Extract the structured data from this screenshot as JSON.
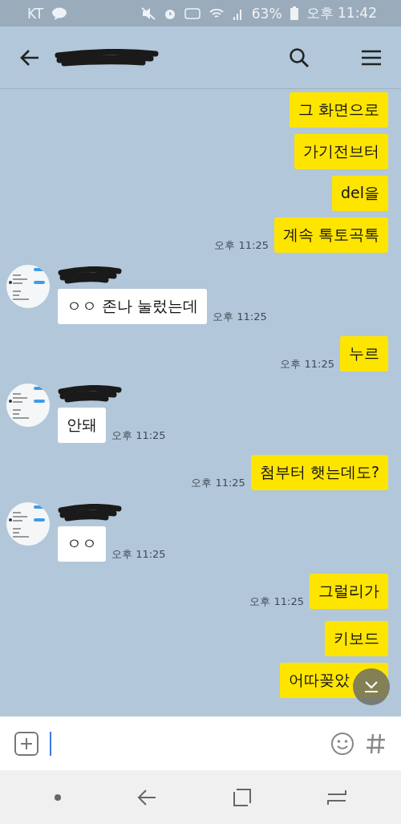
{
  "status_bar": {
    "carrier": "KT",
    "battery": "63%",
    "time": "오후 11:42"
  },
  "groups": [
    {
      "kind": "sent",
      "messages": [
        "그 화면으로",
        "가기전브터",
        "del을",
        "계속 톡토곡톡"
      ],
      "time": "오후 11:25"
    },
    {
      "kind": "received",
      "messages": [
        "ㅇㅇ 존나 눌렀는데"
      ],
      "time": "오후 11:25"
    },
    {
      "kind": "sent",
      "messages": [
        "누르"
      ],
      "time": "오후 11:25"
    },
    {
      "kind": "received",
      "messages": [
        "안돼"
      ],
      "time": "오후 11:25"
    },
    {
      "kind": "sent",
      "messages": [
        "첨부터 햇는데도?"
      ],
      "time": "오후 11:25"
    },
    {
      "kind": "received",
      "messages": [
        "ㅇㅇ"
      ],
      "time": "오후 11:25"
    },
    {
      "kind": "sent",
      "messages": [
        "그럴리가"
      ],
      "time": "오후 11:25"
    },
    {
      "kind": "sent",
      "messages": [
        "키보드",
        "어따꽂았"
      ]
    }
  ]
}
